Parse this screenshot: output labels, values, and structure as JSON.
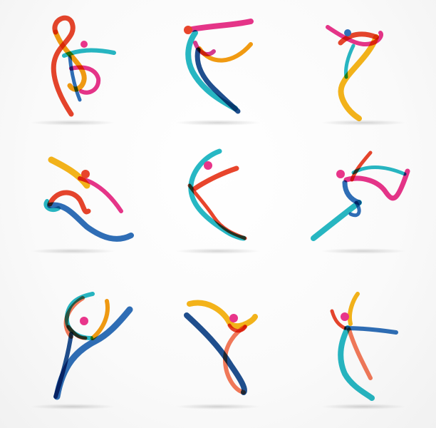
{
  "palette": {
    "orange": "#f39c12",
    "red": "#e8452c",
    "pink": "#e8358a",
    "magenta": "#d63a8f",
    "teal": "#27b8c4",
    "blue": "#2f6fb8",
    "navy": "#1f4f8f",
    "yellow": "#f6b51a",
    "salmon": "#f47a5a"
  },
  "figures": [
    {
      "name": "figure-dancer-1"
    },
    {
      "name": "figure-dancer-2"
    },
    {
      "name": "figure-dancer-3"
    },
    {
      "name": "figure-runner-4"
    },
    {
      "name": "figure-dancer-5"
    },
    {
      "name": "figure-dancer-6"
    },
    {
      "name": "figure-dancer-7"
    },
    {
      "name": "figure-dancer-8"
    },
    {
      "name": "figure-dancer-9"
    }
  ]
}
